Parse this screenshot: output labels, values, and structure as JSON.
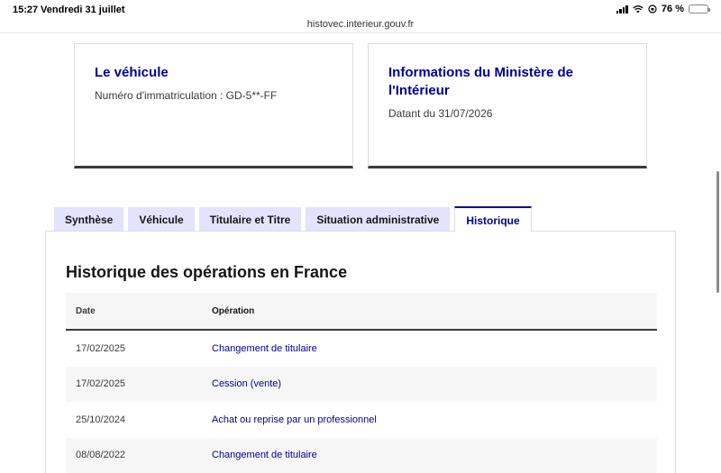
{
  "status_bar": {
    "time": "15:27",
    "date": "Vendredi 31 juillet",
    "battery": "76 %",
    "battery_level": 0.76
  },
  "url": "histovec.interieur.gouv.fr",
  "vehicle_card": {
    "title": "Le véhicule",
    "registration": "Numéro d'immatriculation : GD-5**-FF"
  },
  "ministry_card": {
    "title_line1": "Informations du Ministère de",
    "title_line2": "l'Intérieur",
    "date": "Datant du 31/07/2026"
  },
  "tabs": [
    {
      "label": "Synthèse"
    },
    {
      "label": "Véhicule"
    },
    {
      "label": "Titulaire et Titre"
    },
    {
      "label": "Situation administrative"
    },
    {
      "label": "Historique",
      "active": true
    }
  ],
  "history": {
    "title": "Historique des opérations en France",
    "columns": {
      "date": "Date",
      "operation": "Opération"
    },
    "rows": [
      {
        "date": "17/02/2025",
        "operation": "Changement de titulaire"
      },
      {
        "date": "17/02/2025",
        "operation": "Cession (vente)"
      },
      {
        "date": "25/10/2024",
        "operation": "Achat ou reprise par un professionnel"
      },
      {
        "date": "08/08/2022",
        "operation": "Changement de titulaire"
      }
    ]
  },
  "colors": {
    "accent": "#000091",
    "tab_background": "#e3e3fd",
    "row_stripe": "#f6f6f6"
  }
}
